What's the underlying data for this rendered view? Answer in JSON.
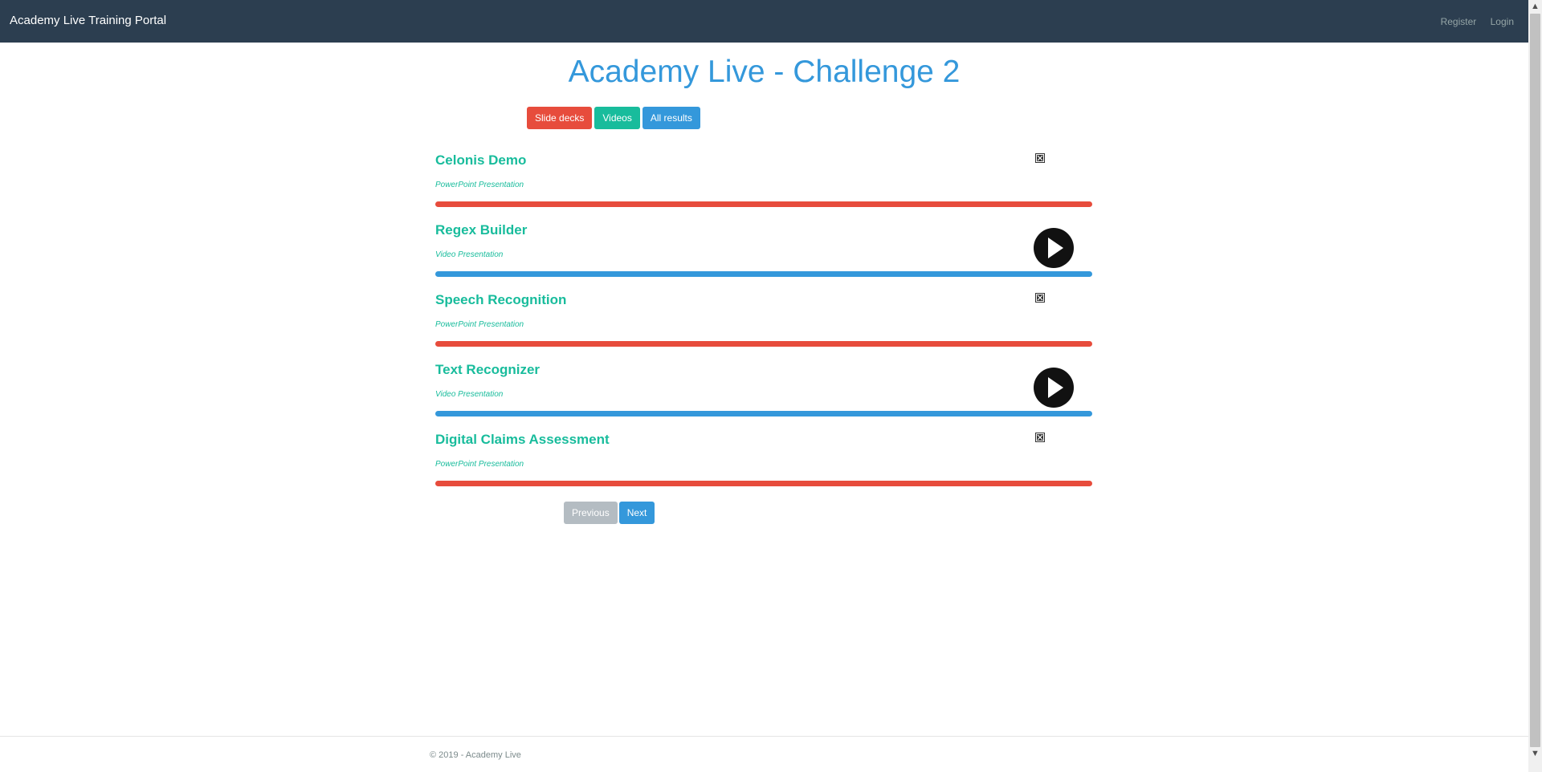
{
  "navbar": {
    "brand": "Academy Live Training Portal",
    "links": [
      "Register",
      "Login"
    ]
  },
  "page": {
    "title": "Academy Live - Challenge 2"
  },
  "filters": {
    "slides": "Slide decks",
    "videos": "Videos",
    "all": "All results"
  },
  "items": [
    {
      "title": "Celonis Demo",
      "type": "PowerPoint Presentation",
      "icon": "broken-image-icon",
      "bar_color": "#e74c3c"
    },
    {
      "title": "Regex Builder",
      "type": "Video Presentation",
      "icon": "play-icon",
      "bar_color": "#3498db"
    },
    {
      "title": "Speech Recognition",
      "type": "PowerPoint Presentation",
      "icon": "broken-image-icon",
      "bar_color": "#e74c3c"
    },
    {
      "title": "Text Recognizer",
      "type": "Video Presentation",
      "icon": "play-icon",
      "bar_color": "#3498db"
    },
    {
      "title": "Digital Claims Assessment",
      "type": "PowerPoint Presentation",
      "icon": "broken-image-icon",
      "bar_color": "#e74c3c"
    }
  ],
  "pager": {
    "previous": "Previous",
    "next": "Next"
  },
  "footer": {
    "text": "© 2019 - Academy Live"
  },
  "colors": {
    "navbar": "#2c3e50",
    "primary": "#3498db",
    "success": "#18bc9c",
    "danger": "#e74c3c",
    "disabled": "#b4bcc2"
  }
}
